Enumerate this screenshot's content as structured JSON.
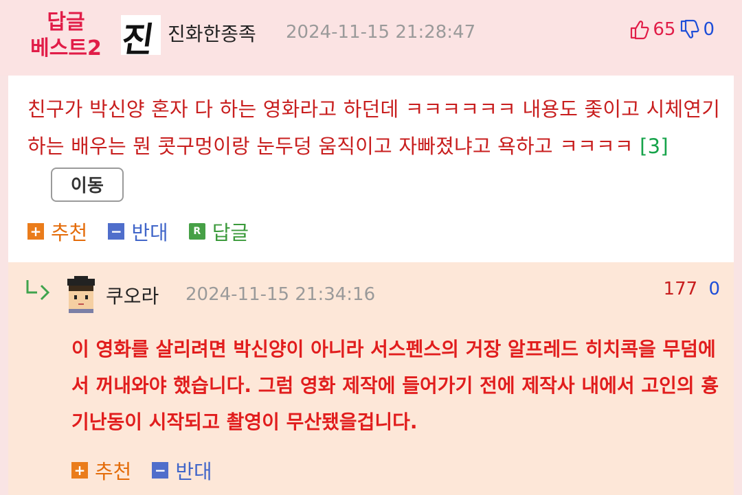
{
  "best_reply": {
    "badge_line1": "답글",
    "badge_line2": "베스트2",
    "avatar_char": "진",
    "nickname": "진화한종족",
    "datetime": "2024-11-15 21:28:47",
    "upvotes": "65",
    "downvotes": "0",
    "text": "친구가 박신양 혼자 다 하는 영화라고 하던데 ㅋㅋㅋㅋㅋㅋ 내용도 좇이고 시체연기 하는 배우는 뭔 콧구멍이랑 눈두덩 움직이고 자빠졌냐고 욕하고 ㅋㅋㅋㅋ",
    "reply_count": "[3]",
    "move_button": "이동",
    "actions": {
      "recommend": "추천",
      "oppose": "반대",
      "reply": "답글",
      "reply_icon_letter": "R"
    }
  },
  "nested_reply": {
    "nickname": "쿠오라",
    "datetime": "2024-11-15 21:34:16",
    "upvotes": "177",
    "downvotes": "0",
    "text": "이 영화를 살리려면 박신양이 아니라 서스펜스의 거장 알프레드 히치콕을 무덤에서 꺼내와야 했습니다. 그럼 영화 제작에 들어가기 전에 제작사 내에서 고인의 흉기난동이 시작되고 촬영이 무산됐을겁니다.",
    "actions": {
      "recommend": "추천",
      "oppose": "반대"
    }
  },
  "icons": {
    "plus": "+",
    "minus": "−",
    "thumb_up": "thumbs-up-icon",
    "thumb_down": "thumbs-down-icon",
    "reply_arrow": "reply-arrow-icon"
  },
  "colors": {
    "accent_red": "#e11d48",
    "vote_blue": "#1d4ed8",
    "recommend_orange": "#ea7c1b",
    "oppose_blue": "#4f6ecb",
    "reply_green": "#46a046"
  }
}
